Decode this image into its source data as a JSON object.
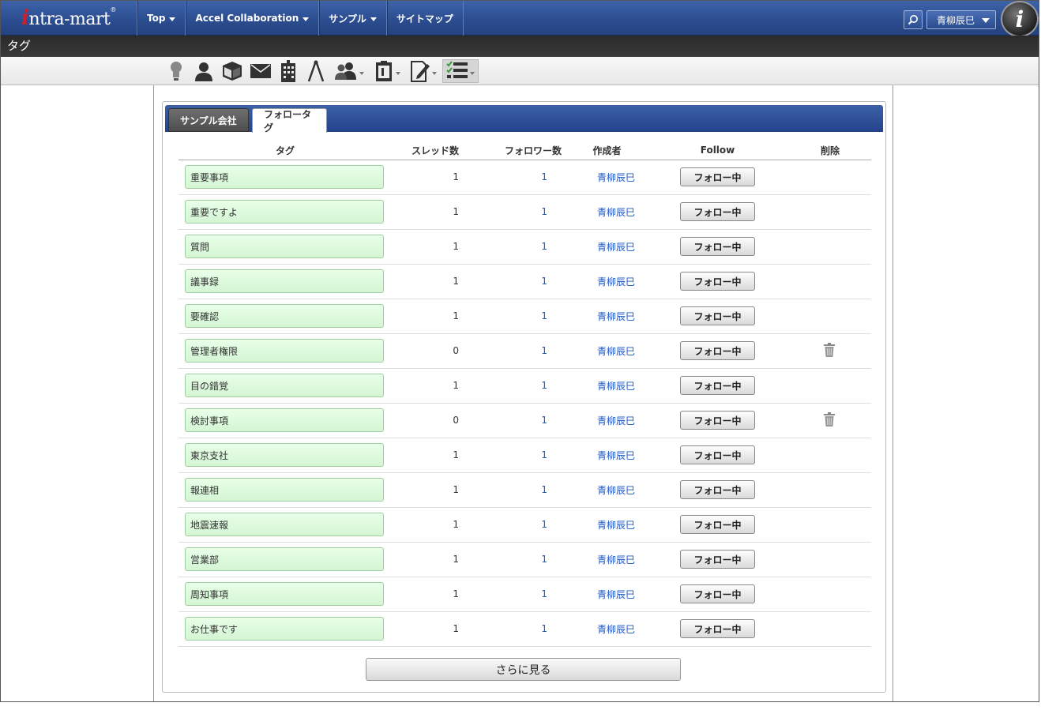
{
  "header": {
    "logo_prefix": "i",
    "logo_text": "ntra-mart",
    "logo_reg": "®",
    "nav": [
      {
        "label": "Top"
      },
      {
        "label": "Accel Collaboration"
      },
      {
        "label": "サンプル"
      },
      {
        "label": "サイトマップ"
      }
    ],
    "user_name": "青柳辰巳",
    "badge": "i"
  },
  "page_title": "タグ",
  "toolbar": {
    "icons": [
      "lightbulb-icon",
      "user-icon",
      "box-icon",
      "mail-icon",
      "building-icon",
      "compass-icon",
      "users-icon",
      "clipboard-icon",
      "edit-icon",
      "checklist-icon"
    ]
  },
  "tabs": [
    {
      "label": "サンプル会社",
      "active": false
    },
    {
      "label": "フォロータグ",
      "active": true
    }
  ],
  "table": {
    "headers": {
      "tag": "タグ",
      "threads": "スレッド数",
      "followers": "フォロワー数",
      "creator": "作成者",
      "follow": "Follow",
      "delete": "削除"
    },
    "rows": [
      {
        "tag": "重要事項",
        "threads": "1",
        "followers": "1",
        "creator": "青柳辰巳",
        "follow": "フォロー中",
        "deletable": false
      },
      {
        "tag": "重要ですよ",
        "threads": "1",
        "followers": "1",
        "creator": "青柳辰巳",
        "follow": "フォロー中",
        "deletable": false
      },
      {
        "tag": "質問",
        "threads": "1",
        "followers": "1",
        "creator": "青柳辰巳",
        "follow": "フォロー中",
        "deletable": false
      },
      {
        "tag": "議事録",
        "threads": "1",
        "followers": "1",
        "creator": "青柳辰巳",
        "follow": "フォロー中",
        "deletable": false
      },
      {
        "tag": "要確認",
        "threads": "1",
        "followers": "1",
        "creator": "青柳辰巳",
        "follow": "フォロー中",
        "deletable": false
      },
      {
        "tag": "管理者権限",
        "threads": "0",
        "followers": "1",
        "creator": "青柳辰巳",
        "follow": "フォロー中",
        "deletable": true
      },
      {
        "tag": "目の錯覚",
        "threads": "1",
        "followers": "1",
        "creator": "青柳辰巳",
        "follow": "フォロー中",
        "deletable": false
      },
      {
        "tag": "検討事項",
        "threads": "0",
        "followers": "1",
        "creator": "青柳辰巳",
        "follow": "フォロー中",
        "deletable": true
      },
      {
        "tag": "東京支社",
        "threads": "1",
        "followers": "1",
        "creator": "青柳辰巳",
        "follow": "フォロー中",
        "deletable": false
      },
      {
        "tag": "報連相",
        "threads": "1",
        "followers": "1",
        "creator": "青柳辰巳",
        "follow": "フォロー中",
        "deletable": false
      },
      {
        "tag": "地震速報",
        "threads": "1",
        "followers": "1",
        "creator": "青柳辰巳",
        "follow": "フォロー中",
        "deletable": false
      },
      {
        "tag": "営業部",
        "threads": "1",
        "followers": "1",
        "creator": "青柳辰巳",
        "follow": "フォロー中",
        "deletable": false
      },
      {
        "tag": "周知事項",
        "threads": "1",
        "followers": "1",
        "creator": "青柳辰巳",
        "follow": "フォロー中",
        "deletable": false
      },
      {
        "tag": "お仕事です",
        "threads": "1",
        "followers": "1",
        "creator": "青柳辰巳",
        "follow": "フォロー中",
        "deletable": false
      }
    ]
  },
  "more_label": "さらに見る",
  "colors": {
    "nav_blue": "#2b4c8f",
    "link": "#1a56c4",
    "tag_green": "#d4f5d4"
  }
}
